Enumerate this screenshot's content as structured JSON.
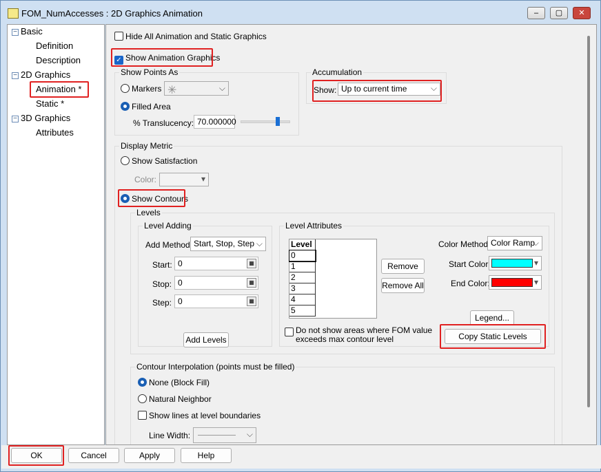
{
  "window": {
    "title": "FOM_NumAccesses : 2D Graphics Animation",
    "controls": [
      "‒",
      "▢",
      "✕"
    ]
  },
  "tree": [
    {
      "label": "Basic",
      "type": "group"
    },
    {
      "label": "Definition",
      "type": "leaf"
    },
    {
      "label": "Description",
      "type": "leaf"
    },
    {
      "label": "2D Graphics",
      "type": "group"
    },
    {
      "label": "Animation *",
      "type": "leaf",
      "selected": true
    },
    {
      "label": "Static *",
      "type": "leaf"
    },
    {
      "label": "3D Graphics",
      "type": "group"
    },
    {
      "label": "Attributes",
      "type": "leaf"
    }
  ],
  "hide_all": "Hide All Animation and Static Graphics",
  "show_anim": "Show Animation Graphics",
  "points": {
    "title": "Show Points As",
    "markers": "Markers",
    "filled": "Filled Area",
    "transl_label": "% Translucency:",
    "transl_value": "70.000000",
    "slider_fraction": 0.75
  },
  "accum": {
    "title": "Accumulation",
    "show_label": "Show:",
    "show_value": "Up to current time"
  },
  "metric": {
    "title": "Display Metric",
    "satisfaction": "Show Satisfaction",
    "color_label": "Color:",
    "contours": "Show Contours"
  },
  "levels": {
    "title": "Levels",
    "adding": {
      "title": "Level Adding",
      "method_label": "Add Method:",
      "method_value": "Start, Stop, Step",
      "start_label": "Start:",
      "start_value": "0",
      "stop_label": "Stop:",
      "stop_value": "0",
      "step_label": "Step:",
      "step_value": "0",
      "add_button": "Add Levels"
    },
    "attrs": {
      "title": "Level Attributes",
      "header": "Level",
      "rows": [
        "0",
        "1",
        "2",
        "3",
        "4",
        "5"
      ],
      "remove": "Remove",
      "remove_all": "Remove All",
      "color_method_label": "Color Method:",
      "color_method_value": "Color Ramp",
      "start_color_label": "Start Color:",
      "start_color": "#00ffff",
      "end_color_label": "End Color:",
      "end_color": "#ff0000",
      "legend": "Legend...",
      "no_show": "Do not show areas where FOM value exceeds max contour level",
      "copy": "Copy Static Levels"
    }
  },
  "interp": {
    "title": "Contour Interpolation (points must be filled)",
    "none": "None (Block Fill)",
    "natural": "Natural Neighbor",
    "lines": "Show lines at level boundaries",
    "line_width": "Line Width:"
  },
  "buttons": {
    "ok": "OK",
    "cancel": "Cancel",
    "apply": "Apply",
    "help": "Help"
  }
}
